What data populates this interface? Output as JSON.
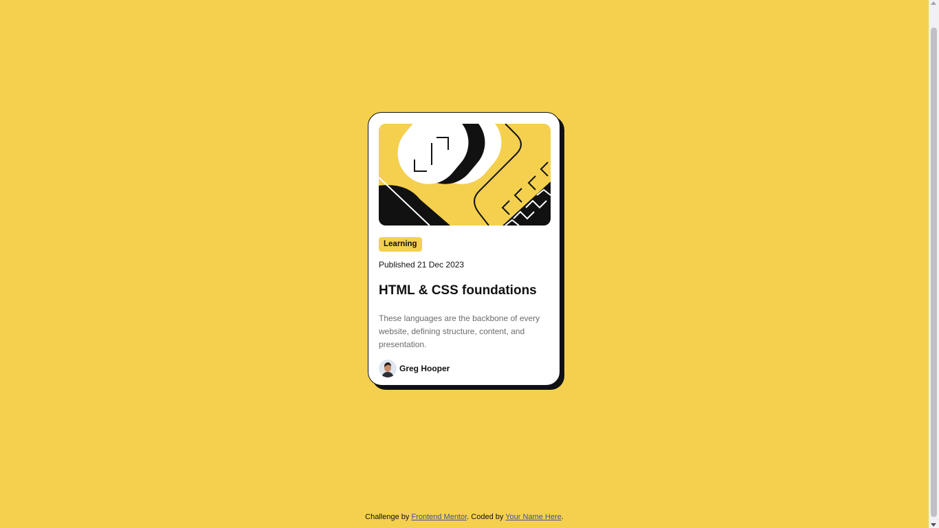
{
  "card": {
    "tag": "Learning",
    "published": "Published 21 Dec 2023",
    "title": "HTML & CSS foundations",
    "description": "These languages are the backbone of every website, defining structure, content, and presentation.",
    "author": "Greg Hooper"
  },
  "footer": {
    "prefix": "Challenge by ",
    "link1": "Frontend Mentor",
    "middle": ". Coded by ",
    "link2": "Your Name Here",
    "suffix": "."
  },
  "colors": {
    "background": "#f4d04e",
    "card": "#ffffff",
    "ink": "#111111",
    "muted": "#6b6b6b",
    "link": "#3e52a3"
  },
  "icons": {
    "hero": "illustration-article",
    "avatar": "image-avatar"
  }
}
